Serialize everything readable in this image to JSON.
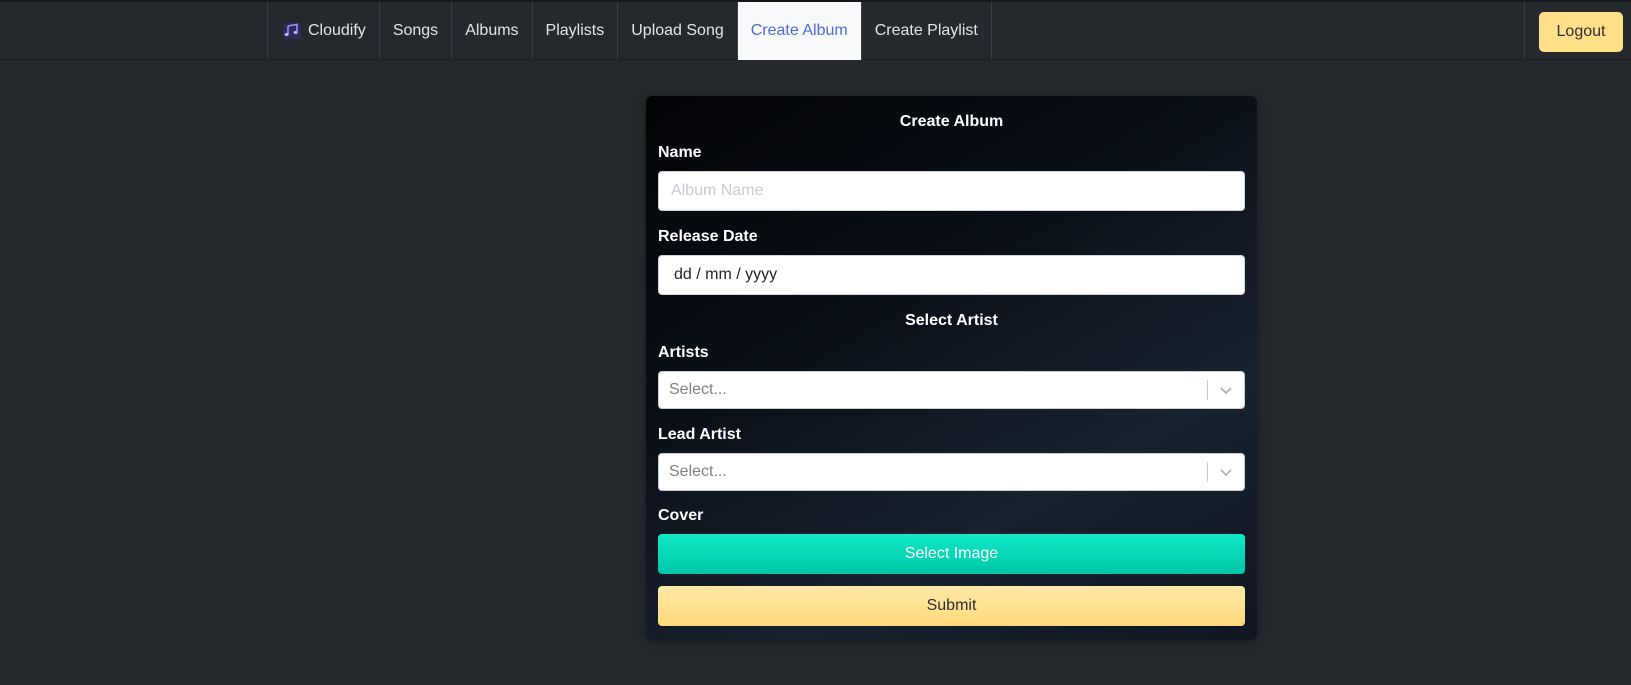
{
  "navbar": {
    "brand": {
      "icon": "music-notes-icon",
      "label": "Cloudify"
    },
    "items": [
      {
        "label": "Songs",
        "active": false
      },
      {
        "label": "Albums",
        "active": false
      },
      {
        "label": "Playlists",
        "active": false
      },
      {
        "label": "Upload Song",
        "active": false
      },
      {
        "label": "Create Album",
        "active": true
      },
      {
        "label": "Create Playlist",
        "active": false
      }
    ],
    "logout_label": "Logout"
  },
  "form": {
    "title": "Create Album",
    "name": {
      "label": "Name",
      "placeholder": "Album Name",
      "value": ""
    },
    "release_date": {
      "label": "Release Date",
      "value": "dd / mm / yyyy"
    },
    "section_title": "Select Artist",
    "artists": {
      "label": "Artists",
      "placeholder": "Select..."
    },
    "lead_artist": {
      "label": "Lead Artist",
      "placeholder": "Select..."
    },
    "cover": {
      "label": "Cover",
      "button_label": "Select Image"
    },
    "submit_label": "Submit"
  },
  "colors": {
    "background": "#25282d",
    "active_tab_text": "#4a6cd4",
    "accent_yellow": "#ffdf87",
    "accent_teal": "#00d5b5"
  }
}
